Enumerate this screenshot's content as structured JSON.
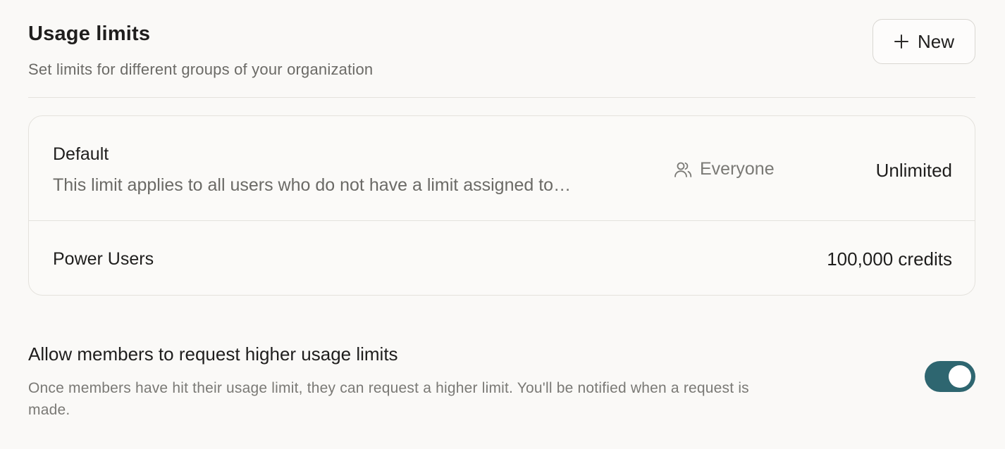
{
  "header": {
    "title": "Usage limits",
    "subtitle": "Set limits for different groups of your organization",
    "new_button_label": "New",
    "new_button_icon": "plus-icon"
  },
  "limits": [
    {
      "name": "Default",
      "description": "This limit applies to all users who do not have a limit assigned to…",
      "group_label": "Everyone",
      "group_icon": "users-icon",
      "value": "Unlimited"
    },
    {
      "name": "Power Users",
      "value": "100,000 credits"
    }
  ],
  "request_setting": {
    "title": "Allow members to request higher usage limits",
    "description": "Once members have hit their usage limit, they can request a higher limit. You'll be notified when a request is made.",
    "enabled": true
  },
  "colors": {
    "toggle_on": "#2e6670",
    "background": "#faf9f7"
  }
}
